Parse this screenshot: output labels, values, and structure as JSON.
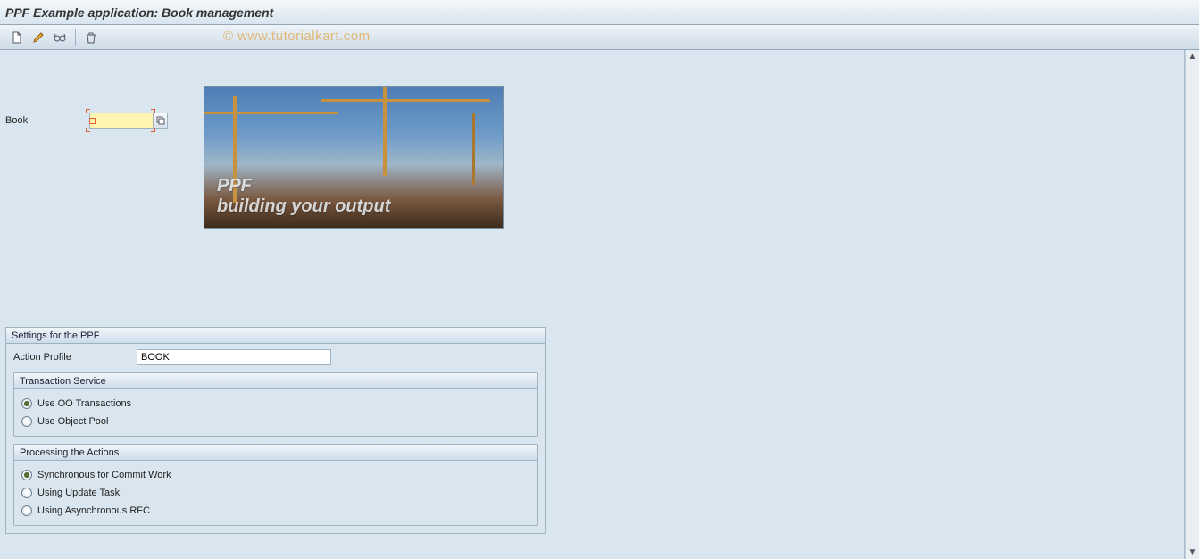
{
  "title": "PPF Example application: Book management",
  "watermark": "© www.tutorialkart.com",
  "toolbar": {
    "create_tip": "Create",
    "change_tip": "Change",
    "display_tip": "Display",
    "delete_tip": "Delete"
  },
  "book": {
    "label": "Book",
    "value": "",
    "f4_tip": "Search help"
  },
  "photo": {
    "caption_line1": "PPF",
    "caption_line2": "building your output"
  },
  "settings": {
    "panel_title": "Settings for the PPF",
    "action_profile_label": "Action Profile",
    "action_profile_value": "BOOK",
    "transaction_service": {
      "title": "Transaction Service",
      "options": [
        {
          "label": "Use OO Transactions",
          "checked": true
        },
        {
          "label": "Use Object Pool",
          "checked": false
        }
      ]
    },
    "processing": {
      "title": "Processing the Actions",
      "options": [
        {
          "label": "Synchronous for Commit Work",
          "checked": true
        },
        {
          "label": "Using Update Task",
          "checked": false
        },
        {
          "label": "Using Asynchronous RFC",
          "checked": false
        }
      ]
    }
  }
}
